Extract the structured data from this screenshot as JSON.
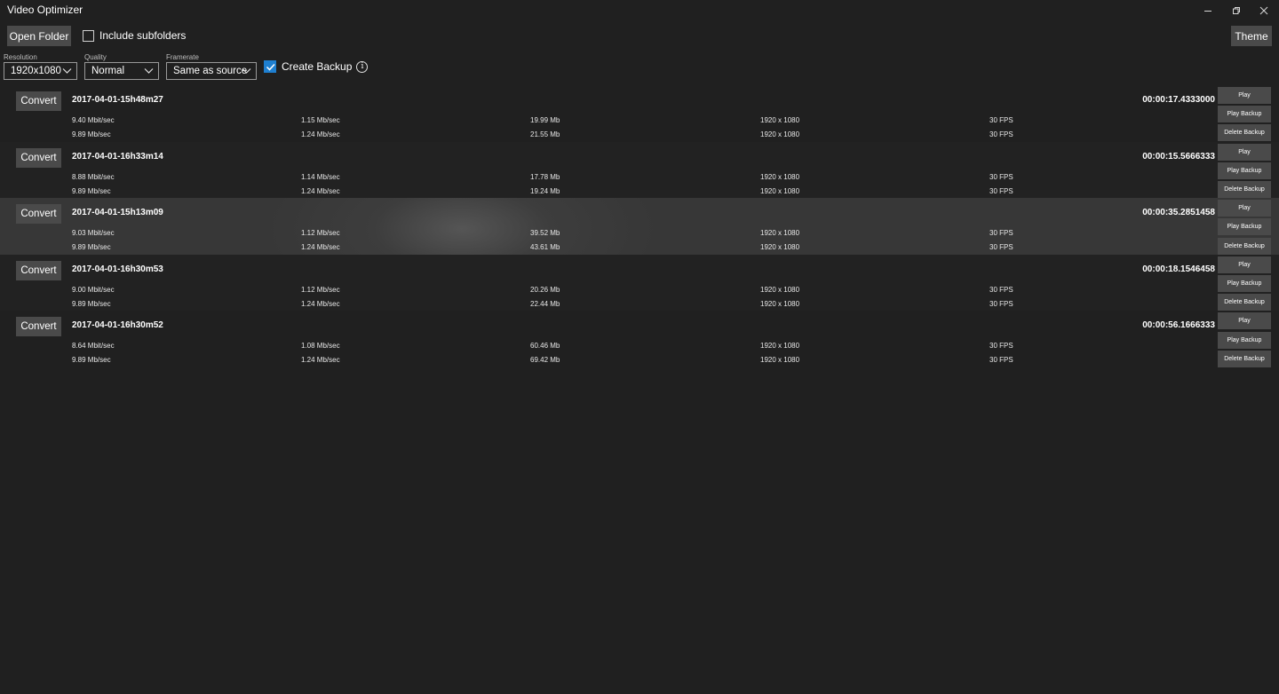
{
  "window": {
    "title": "Video Optimizer"
  },
  "toolbar": {
    "open_folder": "Open Folder",
    "include_subfolders": "Include subfolders",
    "theme": "Theme",
    "resolution_label": "Resolution",
    "resolution_value": "1920x1080",
    "quality_label": "Quality",
    "quality_value": "Normal",
    "framerate_label": "Framerate",
    "framerate_value": "Same as source",
    "create_backup": "Create Backup",
    "include_subfolders_checked": false,
    "create_backup_checked": true
  },
  "actions": {
    "convert": "Convert",
    "play": "Play",
    "play_backup": "Play Backup",
    "delete_backup": "Delete Backup"
  },
  "videos": [
    {
      "name": "2017-04-01-15h48m27",
      "duration": "00:00:17.4333000",
      "current": [
        "9.40 Mbit/sec",
        "1.15 Mb/sec",
        "19.99 Mb",
        "1920 x 1080",
        "30 FPS"
      ],
      "backup": [
        "9.89 Mb/sec",
        "1.24 Mb/sec",
        "21.55 Mb",
        "1920 x 1080",
        "30 FPS"
      ]
    },
    {
      "name": "2017-04-01-16h33m14",
      "duration": "00:00:15.5666333",
      "current": [
        "8.88 Mbit/sec",
        "1.14 Mb/sec",
        "17.78 Mb",
        "1920 x 1080",
        "30 FPS"
      ],
      "backup": [
        "9.89 Mb/sec",
        "1.24 Mb/sec",
        "19.24 Mb",
        "1920 x 1080",
        "30 FPS"
      ]
    },
    {
      "name": "2017-04-01-15h13m09",
      "duration": "00:00:35.2851458",
      "current": [
        "9.03 Mbit/sec",
        "1.12 Mb/sec",
        "39.52 Mb",
        "1920 x 1080",
        "30 FPS"
      ],
      "backup": [
        "9.89 Mb/sec",
        "1.24 Mb/sec",
        "43.61 Mb",
        "1920 x 1080",
        "30 FPS"
      ]
    },
    {
      "name": "2017-04-01-16h30m53",
      "duration": "00:00:18.1546458",
      "current": [
        "9.00 Mbit/sec",
        "1.12 Mb/sec",
        "20.26 Mb",
        "1920 x 1080",
        "30 FPS"
      ],
      "backup": [
        "9.89 Mb/sec",
        "1.24 Mb/sec",
        "22.44 Mb",
        "1920 x 1080",
        "30 FPS"
      ]
    },
    {
      "name": "2017-04-01-16h30m52",
      "duration": "00:00:56.1666333",
      "current": [
        "8.64 Mbit/sec",
        "1.08 Mb/sec",
        "60.46 Mb",
        "1920 x 1080",
        "30 FPS"
      ],
      "backup": [
        "9.89 Mb/sec",
        "1.24 Mb/sec",
        "69.42 Mb",
        "1920 x 1080",
        "30 FPS"
      ]
    }
  ],
  "selected_index": 2,
  "icons": {
    "minimize": "minimize-icon",
    "restore": "restore-icon",
    "close": "close-icon",
    "chevron": "chevron-down-icon",
    "info": "info-icon",
    "check": "check-icon"
  },
  "colors": {
    "background": "#202020",
    "button": "#4a4a4a",
    "accent": "#1e7fd0",
    "selected_row": "#3d3d3d"
  }
}
